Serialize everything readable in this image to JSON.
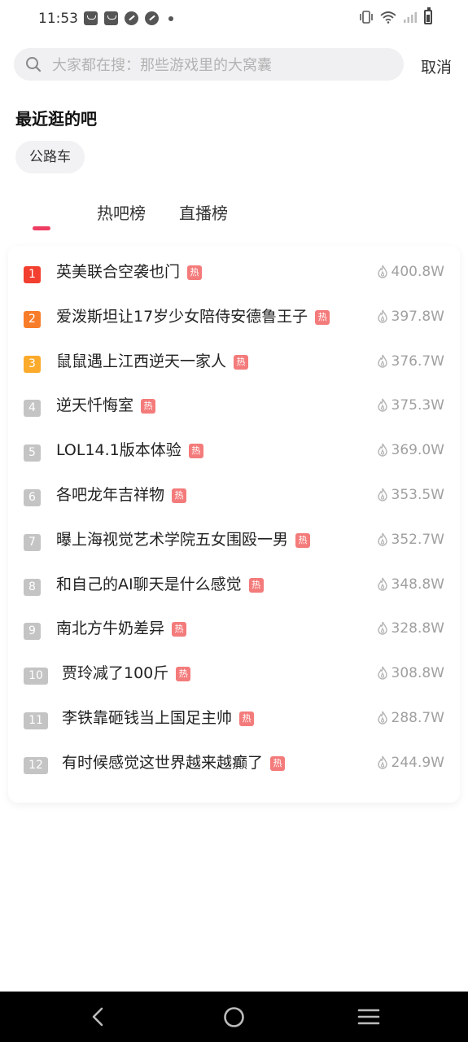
{
  "status_bar": {
    "time": "11:53",
    "left_icons": [
      "notification-bag-icon",
      "notification-bag-icon",
      "app-circle-icon",
      "app-circle-icon",
      "dot-icon"
    ],
    "right_icons": [
      "vibrate-icon",
      "wifi-icon",
      "signal-icon",
      "battery-icon"
    ]
  },
  "search": {
    "placeholder": "大家都在搜：那些游戏里的大窝囊",
    "value": "",
    "cancel_label": "取消"
  },
  "recent": {
    "title": "最近逛的吧",
    "items": [
      "公路车"
    ]
  },
  "tabs": [
    {
      "label": "",
      "active": true
    },
    {
      "label": "热吧榜",
      "active": false
    },
    {
      "label": "直播榜",
      "active": false
    }
  ],
  "hot_badge_label": "热",
  "colors": {
    "rank1": "#f23f2f",
    "rank2": "#f87d2a",
    "rank3": "#fbaa2b",
    "rank_other": "#c4c4c4",
    "hot_badge": "#f47b7b",
    "accent": "#ee3d63"
  },
  "hot_list": [
    {
      "rank": "1",
      "title": "英美联合空袭也门",
      "heat": "400.8W"
    },
    {
      "rank": "2",
      "title": "爱泼斯坦让17岁少女陪侍安德鲁王子",
      "heat": "397.8W"
    },
    {
      "rank": "3",
      "title": "鼠鼠遇上江西逆天一家人",
      "heat": "376.7W"
    },
    {
      "rank": "4",
      "title": "逆天忏悔室",
      "heat": "375.3W"
    },
    {
      "rank": "5",
      "title": "LOL14.1版本体验",
      "heat": "369.0W"
    },
    {
      "rank": "6",
      "title": "各吧龙年吉祥物",
      "heat": "353.5W"
    },
    {
      "rank": "7",
      "title": "曝上海视觉艺术学院五女围殴一男",
      "heat": "352.7W"
    },
    {
      "rank": "8",
      "title": "和自己的AI聊天是什么感觉",
      "heat": "348.8W"
    },
    {
      "rank": "9",
      "title": "南北方牛奶差异",
      "heat": "328.8W"
    },
    {
      "rank": "10",
      "title": "贾玲减了100斤",
      "heat": "308.8W"
    },
    {
      "rank": "11",
      "title": "李铁靠砸钱当上国足主帅",
      "heat": "288.7W"
    },
    {
      "rank": "12",
      "title": "有时候感觉这世界越来越癫了",
      "heat": "244.9W"
    }
  ],
  "nav_bar": {
    "buttons": [
      "back-icon",
      "home-icon",
      "menu-icon"
    ]
  }
}
